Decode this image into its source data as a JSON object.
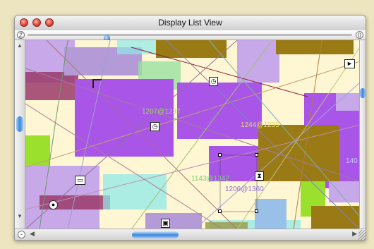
{
  "window": {
    "title": "Display List View"
  },
  "zoom_slider": {
    "left_label": "Z",
    "right_label": "0"
  },
  "bottom_scroll": {
    "left_label": "-"
  },
  "canvas": {
    "labels": [
      {
        "text": "1207@1237",
        "color": "#9bdc5a"
      },
      {
        "text": "1244@1255",
        "color": "#e9d96a"
      },
      {
        "text": "1143@1342",
        "color": "#7ad070"
      },
      {
        "text": "1206@1360",
        "color": "#8a6fcf"
      },
      {
        "text": "140",
        "color": "#c9c9ff"
      }
    ],
    "icons": [
      "corner-icon",
      "clock-icon",
      "clock-icon",
      "hourglass-icon",
      "ruler-icon",
      "globe-icon",
      "monitor-icon",
      "back-arrow-icon",
      "arrow-right-icon"
    ]
  },
  "colors": {
    "purple": "#a855e8",
    "olive": "#9a7a14",
    "lime": "#9be02c",
    "cyan": "#8fe8e8",
    "lavender": "#c7a8e8",
    "maroon": "#9a3a6a",
    "bg": "#fff7d4"
  }
}
